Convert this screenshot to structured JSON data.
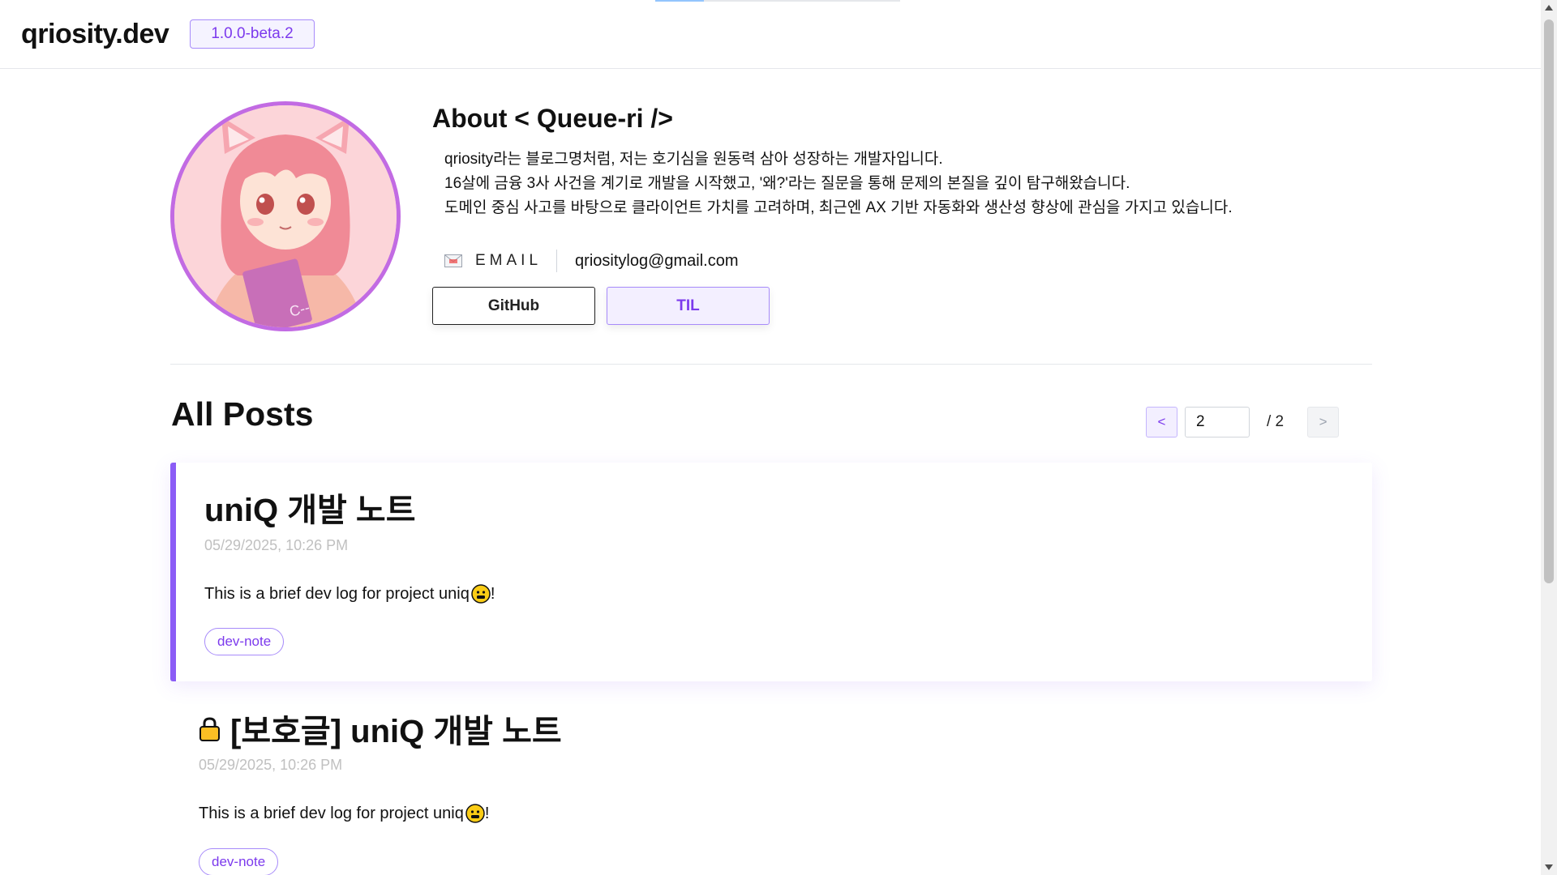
{
  "header": {
    "logo": "qriosity.dev",
    "version": "1.0.0-beta.2"
  },
  "top_progress": {
    "value": 0.2
  },
  "profile": {
    "title": "About < Queue-ri />",
    "lines": [
      "qriosity라는 블로그명처럼, 저는 호기심을 원동력 삼아 성장하는 개발자입니다.",
      "16살에 금융 3사 사건을 계기로 개발을 시작했고, '왜?'라는 질문을 통해 문제의 본질을 깊이 탐구해왔습니다.",
      "도메인 중심 사고를 바탕으로 클라이언트 가치를 고려하며, 최근엔 AX 기반 자동화와 생산성 향상에 관심을 가지고 있습니다."
    ],
    "email_label": "EMAIL",
    "email": "qriositylog@gmail.com",
    "github_label": "GitHub",
    "til_label": "TIL",
    "avatar_book_text": "C--"
  },
  "posts": {
    "title": "All Posts",
    "pagination": {
      "prev": "<",
      "current": "2",
      "total": "/ 2",
      "next": ">"
    },
    "items": [
      {
        "title": "uniQ 개발 노트",
        "date": "05/29/2025, 10:26 PM",
        "excerpt": "This is a brief dev log for project uniq",
        "excerpt_suffix": "!",
        "tag": "dev-note",
        "protected": false
      },
      {
        "title": "[보호글] uniQ 개발 노트",
        "date": "05/29/2025, 10:26 PM",
        "excerpt": "This is a brief dev log for project uniq",
        "excerpt_suffix": "!",
        "tag": "dev-note",
        "protected": true
      }
    ]
  },
  "colors": {
    "accent": "#8b5cf6",
    "accent_text": "#7c3aed",
    "accent_bg": "#f3efff",
    "avatar_ring": "#c26be3"
  },
  "icons": {
    "mail": "envelope-icon",
    "lock": "lock-icon",
    "emoji": "smiley-emoji-icon"
  }
}
